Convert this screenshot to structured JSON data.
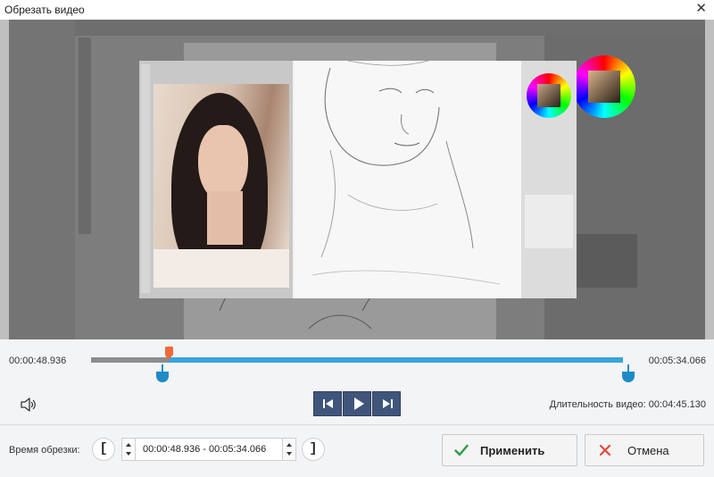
{
  "window": {
    "title": "Обрезать видео",
    "close_label": "✕"
  },
  "timeline": {
    "start_time": "00:00:48.936",
    "end_time": "00:05:34.066",
    "playhead_fraction": 0.15,
    "selection_start_fraction": 0.15,
    "selection_end_fraction": 1.0,
    "colors": {
      "selected": "#3aa4de",
      "unselected": "#8d8d8d",
      "playhead": "#f0693a"
    }
  },
  "playback": {
    "prev_icon": "skip-back-icon",
    "play_icon": "play-icon",
    "next_icon": "skip-forward-icon",
    "volume_icon": "speaker-icon"
  },
  "duration": {
    "text": "Длительность видео: 00:04:45.130"
  },
  "trim": {
    "label": "Время обрезки:",
    "left_bracket": "[",
    "right_bracket": "]",
    "value": "00:00:48.936 - 00:05:34.066"
  },
  "buttons": {
    "apply_label": "Применить",
    "cancel_label": "Отмена",
    "apply_icon_color": "#2e9a48",
    "cancel_icon_color": "#e04b3a"
  }
}
